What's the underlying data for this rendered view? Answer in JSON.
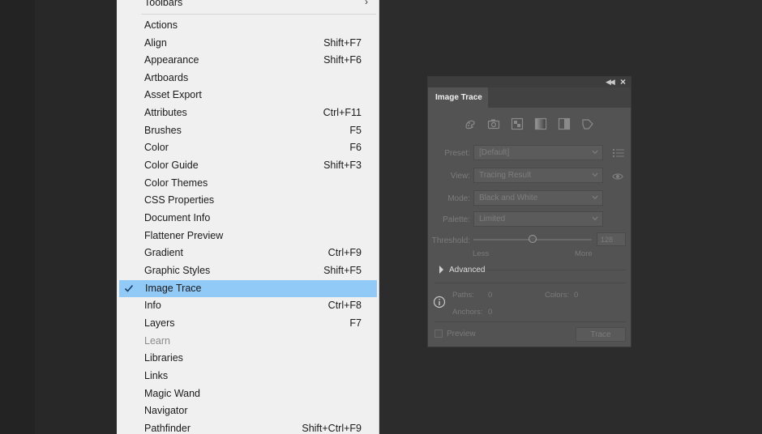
{
  "menu": {
    "items": [
      {
        "label": "Toolbars",
        "shortcut": "",
        "submenu": true
      },
      {
        "label": "Actions",
        "shortcut": ""
      },
      {
        "label": "Align",
        "shortcut": "Shift+F7"
      },
      {
        "label": "Appearance",
        "shortcut": "Shift+F6"
      },
      {
        "label": "Artboards",
        "shortcut": ""
      },
      {
        "label": "Asset Export",
        "shortcut": ""
      },
      {
        "label": "Attributes",
        "shortcut": "Ctrl+F11"
      },
      {
        "label": "Brushes",
        "shortcut": "F5"
      },
      {
        "label": "Color",
        "shortcut": "F6"
      },
      {
        "label": "Color Guide",
        "shortcut": "Shift+F3"
      },
      {
        "label": "Color Themes",
        "shortcut": ""
      },
      {
        "label": "CSS Properties",
        "shortcut": ""
      },
      {
        "label": "Document Info",
        "shortcut": ""
      },
      {
        "label": "Flattener Preview",
        "shortcut": ""
      },
      {
        "label": "Gradient",
        "shortcut": "Ctrl+F9"
      },
      {
        "label": "Graphic Styles",
        "shortcut": "Shift+F5"
      },
      {
        "label": "Image Trace",
        "shortcut": "",
        "checked": true,
        "selected": true
      },
      {
        "label": "Info",
        "shortcut": "Ctrl+F8"
      },
      {
        "label": "Layers",
        "shortcut": "F7"
      },
      {
        "label": "Learn",
        "shortcut": "",
        "disabled": true
      },
      {
        "label": "Libraries",
        "shortcut": ""
      },
      {
        "label": "Links",
        "shortcut": ""
      },
      {
        "label": "Magic Wand",
        "shortcut": ""
      },
      {
        "label": "Navigator",
        "shortcut": ""
      },
      {
        "label": "Pathfinder",
        "shortcut": "Shift+Ctrl+F9"
      }
    ]
  },
  "panel": {
    "tab_label": "Image Trace",
    "preset": {
      "label": "Preset:",
      "value": "[Default]"
    },
    "view": {
      "label": "View:",
      "value": "Tracing Result"
    },
    "mode": {
      "label": "Mode:",
      "value": "Black and White"
    },
    "palette": {
      "label": "Palette:",
      "value": "Limited"
    },
    "threshold": {
      "label": "Threshold:",
      "value": "128",
      "min_label": "Less",
      "max_label": "More",
      "level": 0.5
    },
    "advanced_label": "Advanced",
    "stats": {
      "paths_label": "Paths:",
      "paths_value": "0",
      "colors_label": "Colors:",
      "colors_value": "0",
      "anchors_label": "Anchors:",
      "anchors_value": "0"
    },
    "preview_label": "Preview",
    "trace_button": "Trace"
  },
  "icons": {
    "preset_row": [
      "auto-color-icon",
      "high-color-icon",
      "low-color-icon",
      "grayscale-icon",
      "black-and-white-icon",
      "outline-icon"
    ],
    "collapse": "double-chevron-left-icon",
    "close": "close-icon",
    "view_toggle": "eye-icon",
    "preset_menu": "list-icon",
    "info": "info-icon"
  },
  "colors": {
    "menu_selected": "#91c9f7",
    "panel_bg": "#535353"
  }
}
